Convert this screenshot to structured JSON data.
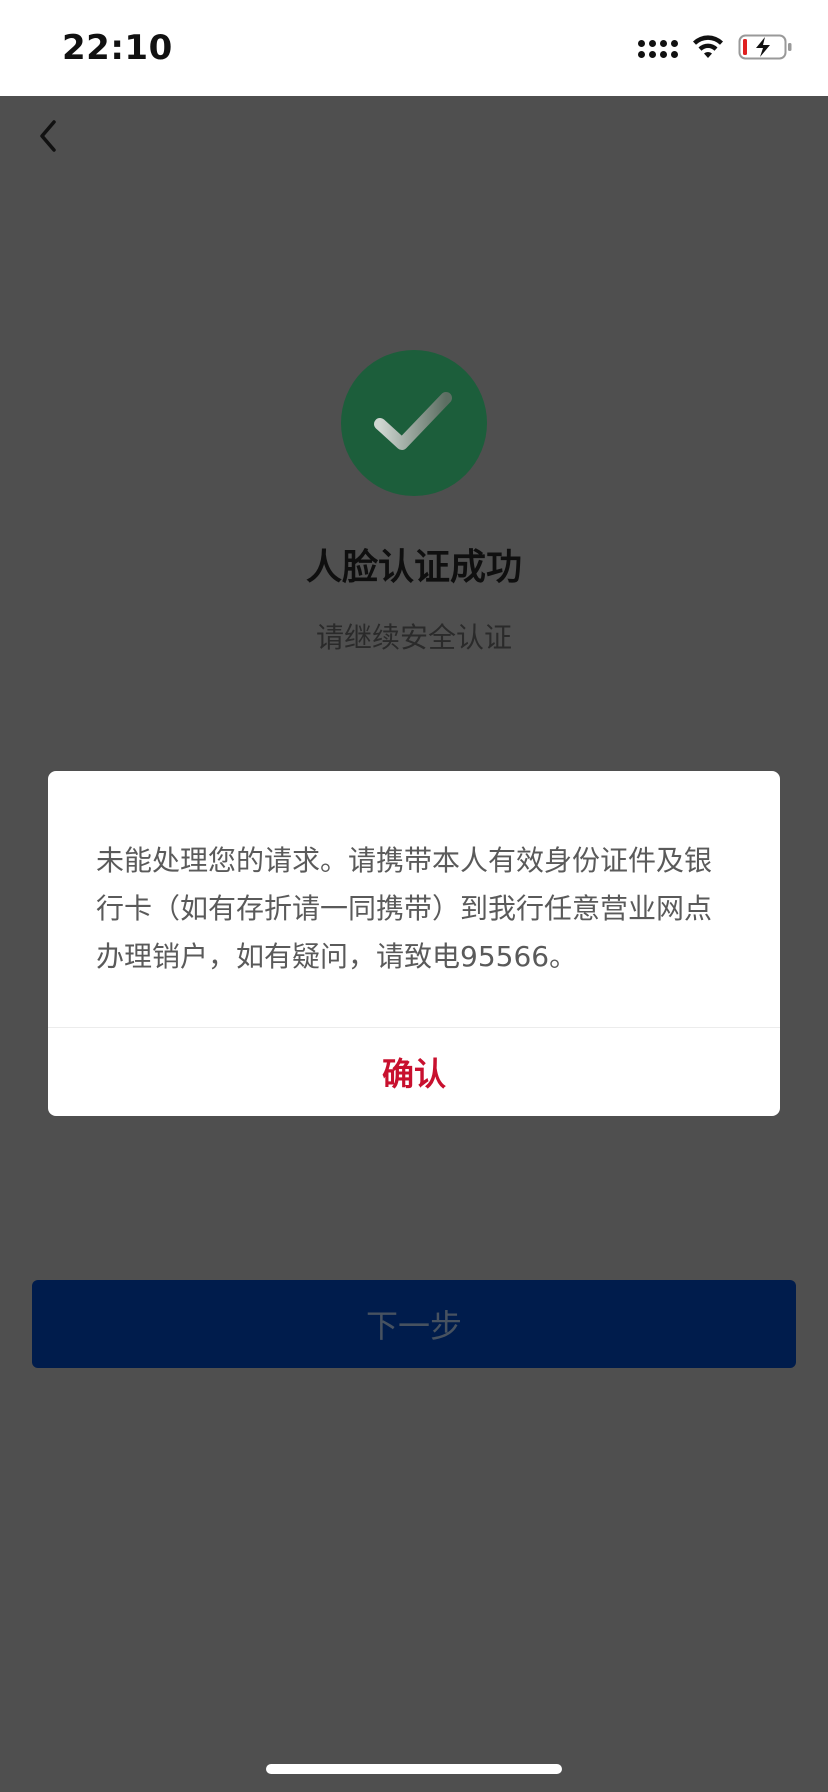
{
  "status_bar": {
    "time": "22:10",
    "icons": [
      "signal-icon",
      "wifi-icon",
      "battery-charging-icon"
    ]
  },
  "nav": {
    "back_icon": "chevron-left-icon"
  },
  "result": {
    "icon": "check-circle-icon",
    "icon_color": "#1c5e3b",
    "title": "人脸认证成功",
    "subtitle": "请继续安全认证"
  },
  "primary_button": {
    "label": "下一步",
    "color": "#001c4c"
  },
  "dialog": {
    "message": "未能处理您的请求。请携带本人有效身份证件及银行卡（如有存折请一同携带）到我行任意营业网点办理销户，如有疑问，请致电95566。",
    "confirm_label": "确认",
    "confirm_color": "#c8102e"
  }
}
